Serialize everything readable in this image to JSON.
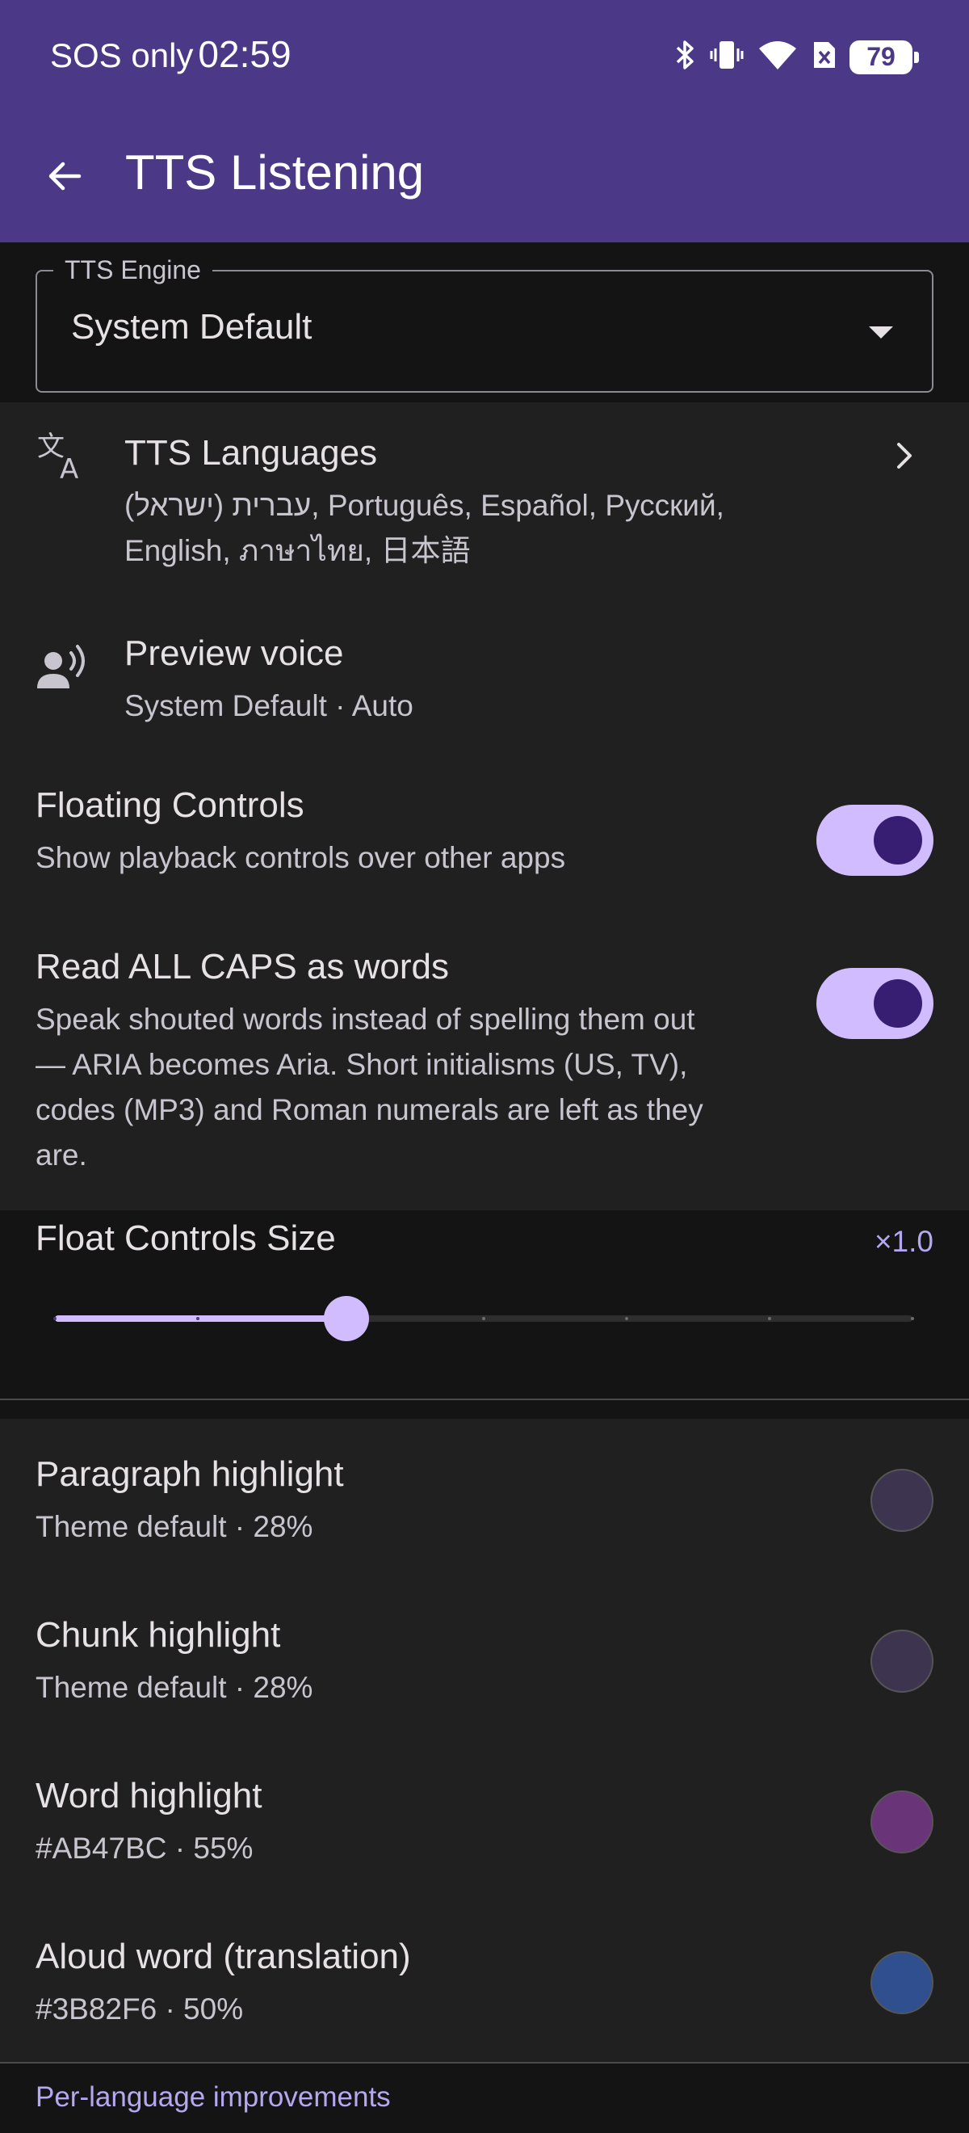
{
  "status_bar": {
    "carrier": "SOS only",
    "time": "02:59",
    "battery": "79",
    "icons": [
      "bluetooth-icon",
      "vibrate-icon",
      "wifi-icon",
      "no-sim-icon",
      "battery-icon"
    ]
  },
  "app_bar": {
    "title": "TTS Listening",
    "back_icon": "arrow-back-icon"
  },
  "engine": {
    "label": "TTS Engine",
    "value": "System Default"
  },
  "languages": {
    "title": "TTS Languages",
    "line1": "(עברית (ישראל, Português, Español, Русский,",
    "line2": "English, ภาษาไทย, 日本語",
    "icon": "translate-icon"
  },
  "preview": {
    "title": "Preview voice",
    "subtitle": "System Default · Auto",
    "icon": "record-voice-icon"
  },
  "floating": {
    "title": "Floating Controls",
    "subtitle": "Show playback controls over other apps",
    "enabled": true
  },
  "caps": {
    "title": "Read ALL CAPS as words",
    "line1": "Speak shouted words instead of spelling them out",
    "line2": "— ARIA becomes Aria. Short initialisms (US, TV),",
    "line3": "codes (MP3) and Roman numerals are left as they",
    "line4": "are.",
    "enabled": true
  },
  "float_size": {
    "title": "Float Controls Size",
    "value_label": "×1.0",
    "slider_fraction": 0.34,
    "steps": 7
  },
  "highlights": [
    {
      "title": "Paragraph highlight",
      "subtitle": "Theme default · 28%",
      "color": "#3d3550"
    },
    {
      "title": "Chunk highlight",
      "subtitle": "Theme default · 28%",
      "color": "#3d3550"
    },
    {
      "title": "Word highlight",
      "subtitle": "#AB47BC · 55%",
      "color": "#6a3478"
    },
    {
      "title": "Aloud word (translation)",
      "subtitle": "#3B82F6 · 50%",
      "color": "#2f4f8e"
    }
  ],
  "footer": {
    "label": "Per-language improvements"
  },
  "colors": {
    "accent": "#4b3887",
    "switch_track": "#d0bcff",
    "switch_thumb": "#381e72"
  }
}
